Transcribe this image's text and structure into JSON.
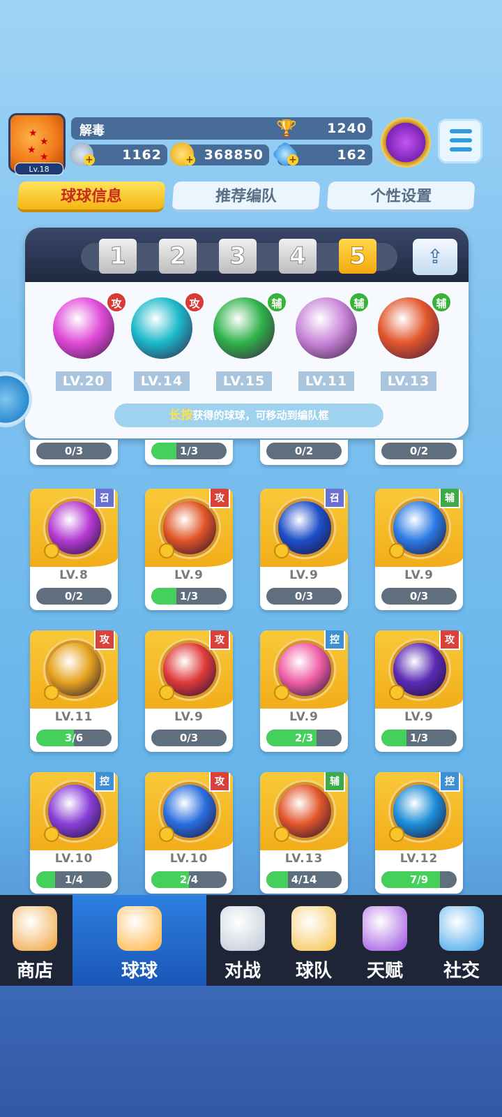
{
  "player": {
    "name": "解毒",
    "level_badge": "Lv.18",
    "trophies": "1240",
    "silver": "1162",
    "gold": "368850",
    "gems": "162"
  },
  "tabs": [
    {
      "label": "球球信息",
      "active": true
    },
    {
      "label": "推荐编队",
      "active": false
    },
    {
      "label": "个性设置",
      "active": false
    }
  ],
  "team_slots": [
    "1",
    "2",
    "3",
    "4",
    "5"
  ],
  "active_slot": "5",
  "team": [
    {
      "tag": "攻",
      "type": "atk",
      "level": "LV.20",
      "color": "#e04ad8"
    },
    {
      "tag": "攻",
      "type": "atk",
      "level": "LV.14",
      "color": "#19b8c9"
    },
    {
      "tag": "辅",
      "type": "sup",
      "level": "LV.15",
      "color": "#2fb24a"
    },
    {
      "tag": "辅",
      "type": "sup",
      "level": "LV.11",
      "color": "#c985d9"
    },
    {
      "tag": "辅",
      "type": "sup",
      "level": "LV.13",
      "color": "#e2562b"
    }
  ],
  "hint": {
    "highlight": "长按",
    "text": "获得的球球，可移动到编队框"
  },
  "partial_row": [
    "0/3",
    "1/3",
    "0/2",
    "0/2"
  ],
  "balls": [
    {
      "tag": "召",
      "type": "sum",
      "level": "LV.8",
      "progress": "0/2",
      "ratio": 0,
      "color": "#b53bd3"
    },
    {
      "tag": "攻",
      "type": "atk",
      "level": "LV.9",
      "progress": "1/3",
      "ratio": 0.33,
      "color": "#e05525"
    },
    {
      "tag": "召",
      "type": "sum",
      "level": "LV.9",
      "progress": "0/3",
      "ratio": 0,
      "color": "#1d4fc8"
    },
    {
      "tag": "辅",
      "type": "sup",
      "level": "LV.9",
      "progress": "0/3",
      "ratio": 0,
      "color": "#2c7be5"
    },
    {
      "tag": "攻",
      "type": "atk",
      "level": "LV.11",
      "progress": "3/6",
      "ratio": 0.5,
      "color": "#e7a320"
    },
    {
      "tag": "攻",
      "type": "atk",
      "level": "LV.9",
      "progress": "0/3",
      "ratio": 0,
      "color": "#e03b3b"
    },
    {
      "tag": "控",
      "type": "ctl",
      "level": "LV.9",
      "progress": "2/3",
      "ratio": 0.67,
      "color": "#f05fa5"
    },
    {
      "tag": "攻",
      "type": "atk",
      "level": "LV.9",
      "progress": "1/3",
      "ratio": 0.33,
      "color": "#5b2bb5"
    },
    {
      "tag": "控",
      "type": "ctl",
      "level": "LV.10",
      "progress": "1/4",
      "ratio": 0.25,
      "color": "#8a3fd8"
    },
    {
      "tag": "攻",
      "type": "atk",
      "level": "LV.10",
      "progress": "2/4",
      "ratio": 0.5,
      "color": "#2a6ee0"
    },
    {
      "tag": "辅",
      "type": "sup",
      "level": "LV.13",
      "progress": "4/14",
      "ratio": 0.29,
      "color": "#e2562b"
    },
    {
      "tag": "控",
      "type": "ctl",
      "level": "LV.12",
      "progress": "7/9",
      "ratio": 0.78,
      "color": "#1d8ed8"
    }
  ],
  "nav": [
    {
      "label": "商店",
      "icon": "shop-icon",
      "active": false
    },
    {
      "label": "球球",
      "icon": "balls-icon",
      "active": true
    },
    {
      "label": "对战",
      "icon": "battle-icon",
      "active": false
    },
    {
      "label": "球队",
      "icon": "team-whistle-icon",
      "active": false
    },
    {
      "label": "天赋",
      "icon": "talent-planet-icon",
      "active": false
    },
    {
      "label": "社交",
      "icon": "social-chat-icon",
      "active": false
    }
  ]
}
